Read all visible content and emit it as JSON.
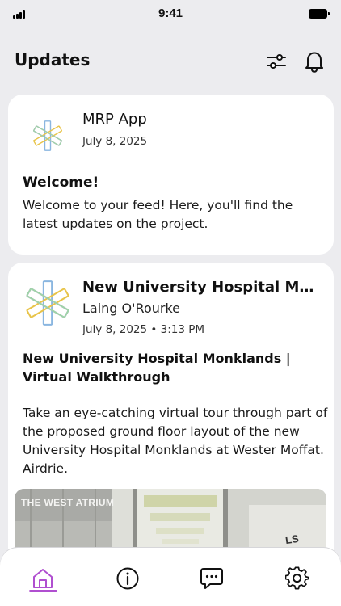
{
  "status_bar": {
    "time": "9:41"
  },
  "header": {
    "title": "Updates"
  },
  "icons": {
    "filter": "sliders-icon",
    "notifications": "bell-icon",
    "home": "home-icon",
    "info": "info-icon",
    "chat": "chat-icon",
    "settings": "gear-icon"
  },
  "colors": {
    "accent": "#b04fd0",
    "background": "#ececef",
    "card": "#ffffff"
  },
  "posts": [
    {
      "author": "MRP App",
      "date": "July 8, 2025",
      "title": "Welcome!",
      "body": "Welcome to your feed! Here, you'll find the latest updates on the project."
    },
    {
      "author": "New University Hospital Monklands",
      "subauthor": "Laing O'Rourke",
      "date": "July 8, 2025 • 3:13 PM",
      "title": "New University Hospital Monklands | Virtual Walkthrough",
      "body": "Take an eye-catching virtual tour through part of the proposed ground floor layout of the new University Hospital Monklands at Wester Moffat. Airdrie.",
      "media_label": "THE WEST ATRIUM",
      "media_sign": "LS"
    }
  ],
  "tab_bar": {
    "active": "home"
  }
}
